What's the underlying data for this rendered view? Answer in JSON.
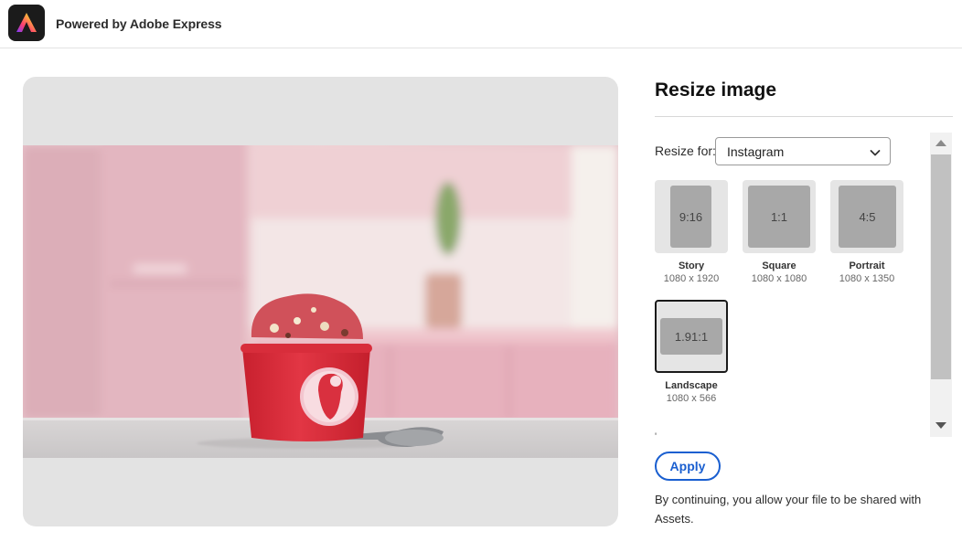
{
  "header": {
    "brand": "Powered by Adobe Express",
    "logo_icon": "adobe-express-logo-icon"
  },
  "preview": {
    "image_subject": "ice-cream-cup-photo"
  },
  "panel": {
    "title": "Resize image",
    "resize_label": "Resize for:",
    "platform": {
      "selected": "Instagram",
      "icon": "chevron-down-icon"
    },
    "presets": [
      {
        "ratio": "9:16",
        "name": "Story",
        "dims": "1080 x 1920",
        "selected": false
      },
      {
        "ratio": "1:1",
        "name": "Square",
        "dims": "1080 x 1080",
        "selected": false
      },
      {
        "ratio": "4:5",
        "name": "Portrait",
        "dims": "1080 x 1350",
        "selected": false
      },
      {
        "ratio": "1.91:1",
        "name": "Landscape",
        "dims": "1080 x 566",
        "selected": true
      }
    ],
    "cut_off_text": "' "
  },
  "actions": {
    "apply_label": "Apply"
  },
  "consent_text": "By continuing, you allow your file to be shared with Assets.",
  "colors": {
    "accent": "#1a5fd0",
    "cup_red": "#e0303c",
    "tile_bg": "#e5e5e5",
    "ratio_fill": "#a8a8a8"
  }
}
